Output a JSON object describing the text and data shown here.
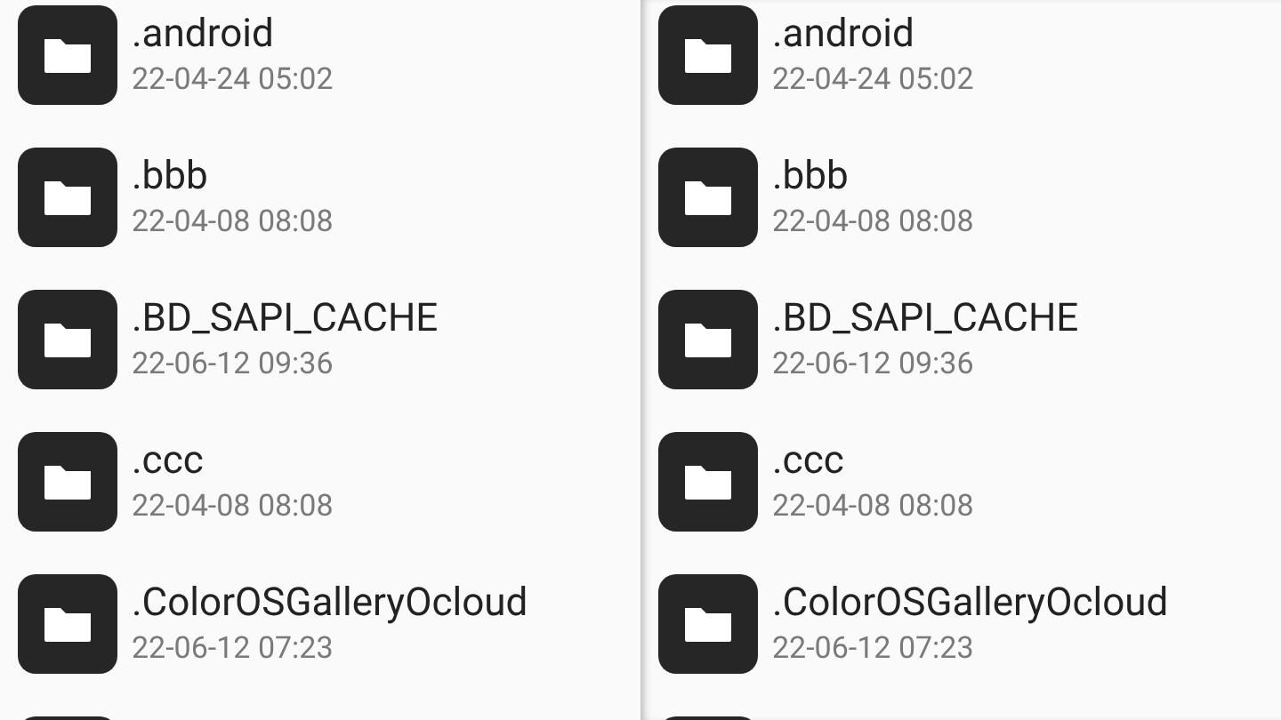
{
  "panes": [
    {
      "items": [
        {
          "name": ".android",
          "date": "22-04-24 05:02"
        },
        {
          "name": ".bbb",
          "date": "22-04-08 08:08"
        },
        {
          "name": ".BD_SAPI_CACHE",
          "date": "22-06-12 09:36"
        },
        {
          "name": ".ccc",
          "date": "22-04-08 08:08"
        },
        {
          "name": ".ColorOSGalleryOcloud",
          "date": "22-06-12 07:23"
        }
      ]
    },
    {
      "items": [
        {
          "name": ".android",
          "date": "22-04-24 05:02"
        },
        {
          "name": ".bbb",
          "date": "22-04-08 08:08"
        },
        {
          "name": ".BD_SAPI_CACHE",
          "date": "22-06-12 09:36"
        },
        {
          "name": ".ccc",
          "date": "22-04-08 08:08"
        },
        {
          "name": ".ColorOSGalleryOcloud",
          "date": "22-06-12 07:23"
        }
      ]
    }
  ]
}
